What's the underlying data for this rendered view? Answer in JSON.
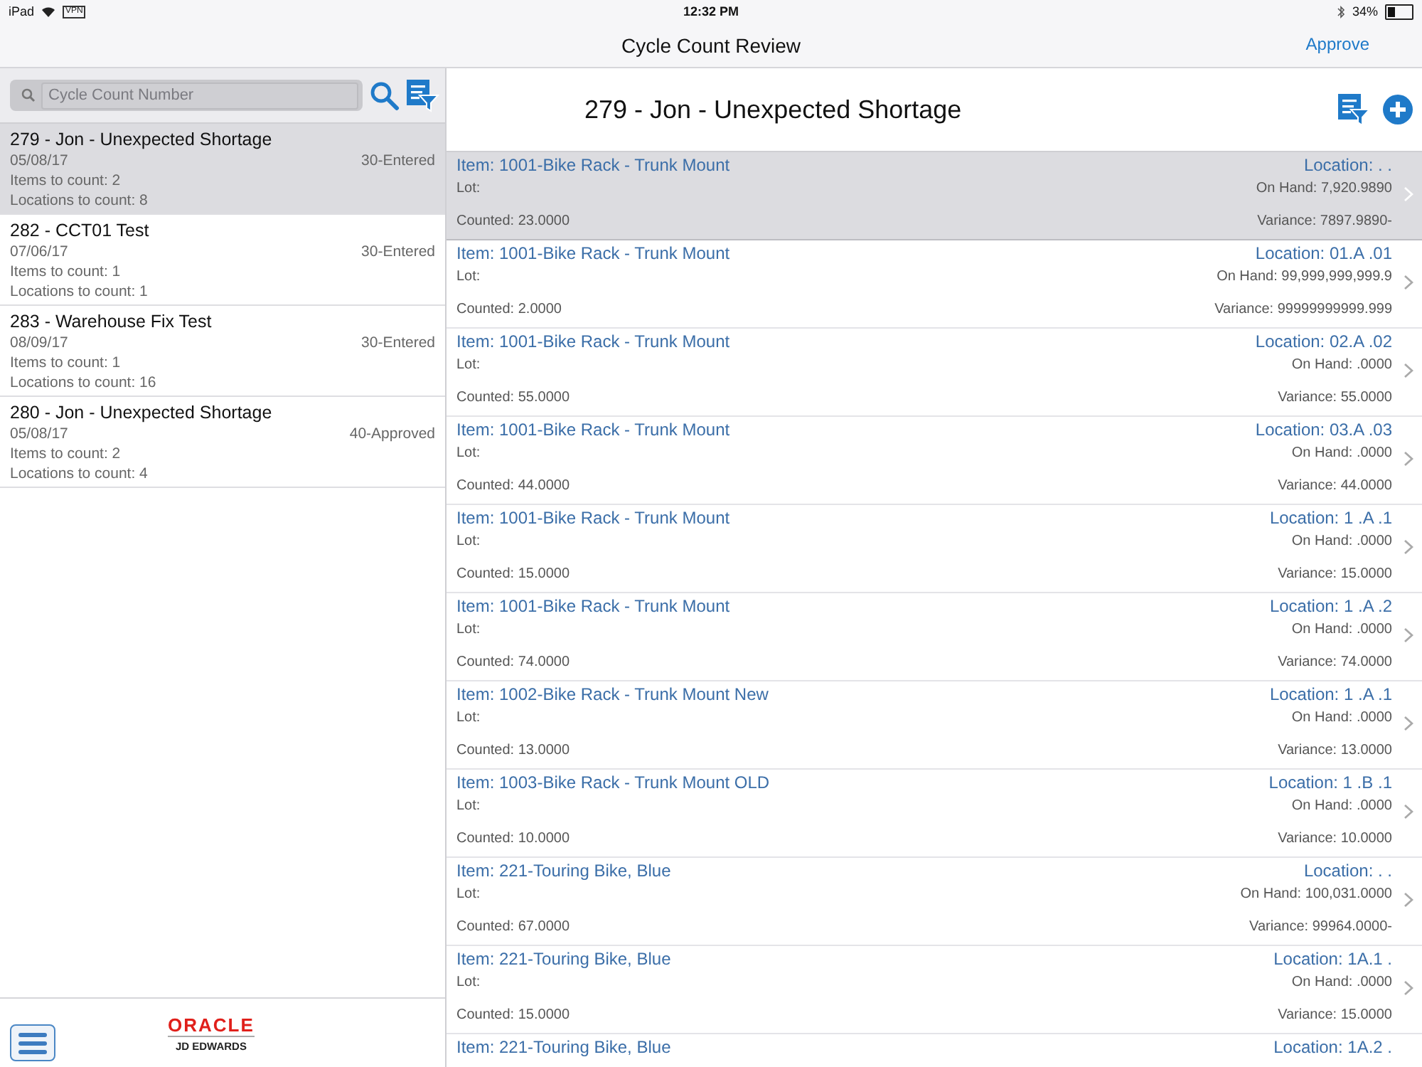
{
  "status_bar": {
    "device": "iPad",
    "vpn": "VPN",
    "time": "12:32 PM",
    "battery": "34%"
  },
  "nav": {
    "title": "Cycle Count Review",
    "action": "Approve"
  },
  "search": {
    "placeholder": "Cycle Count Number"
  },
  "counts": [
    {
      "title": "279 - Jon - Unexpected Shortage",
      "date": "05/08/17",
      "status": "30-Entered",
      "items": "Items to count: 2",
      "locations": "Locations to count: 8",
      "selected": true
    },
    {
      "title": "282 - CCT01 Test",
      "date": "07/06/17",
      "status": "30-Entered",
      "items": "Items to count: 1",
      "locations": "Locations to count: 1",
      "selected": false
    },
    {
      "title": "283 - Warehouse Fix Test",
      "date": "08/09/17",
      "status": "30-Entered",
      "items": "Items to count: 1",
      "locations": "Locations to count: 16",
      "selected": false
    },
    {
      "title": "280 - Jon - Unexpected Shortage",
      "date": "05/08/17",
      "status": "40-Approved",
      "items": "Items to count: 2",
      "locations": "Locations to count: 4",
      "selected": false
    }
  ],
  "logo": {
    "brand": "ORACLE",
    "product": "JD EDWARDS"
  },
  "detail": {
    "title": "279 - Jon - Unexpected Shortage",
    "rows": [
      {
        "item": "Item: 1001-Bike Rack - Trunk Mount",
        "location": "Location: . .",
        "lot": "Lot:",
        "on_hand": "On Hand: 7,920.9890",
        "counted": "Counted: 23.0000",
        "variance": "Variance: 7897.9890-",
        "selected": true
      },
      {
        "item": "Item: 1001-Bike Rack - Trunk Mount",
        "location": "Location: 01.A .01",
        "lot": "Lot:",
        "on_hand": "On Hand: 99,999,999,999.9",
        "counted": "Counted: 2.0000",
        "variance": "Variance: 99999999999.999",
        "selected": false
      },
      {
        "item": "Item: 1001-Bike Rack - Trunk Mount",
        "location": "Location: 02.A .02",
        "lot": "Lot:",
        "on_hand": "On Hand: .0000",
        "counted": "Counted: 55.0000",
        "variance": "Variance: 55.0000",
        "selected": false
      },
      {
        "item": "Item: 1001-Bike Rack - Trunk Mount",
        "location": "Location: 03.A .03",
        "lot": "Lot:",
        "on_hand": "On Hand: .0000",
        "counted": "Counted: 44.0000",
        "variance": "Variance: 44.0000",
        "selected": false
      },
      {
        "item": "Item: 1001-Bike Rack - Trunk Mount",
        "location": "Location: 1 .A .1",
        "lot": "Lot:",
        "on_hand": "On Hand: .0000",
        "counted": "Counted: 15.0000",
        "variance": "Variance: 15.0000",
        "selected": false
      },
      {
        "item": "Item: 1001-Bike Rack - Trunk Mount",
        "location": "Location: 1 .A .2",
        "lot": "Lot:",
        "on_hand": "On Hand: .0000",
        "counted": "Counted: 74.0000",
        "variance": "Variance: 74.0000",
        "selected": false
      },
      {
        "item": "Item: 1002-Bike Rack - Trunk Mount New",
        "location": "Location: 1 .A .1",
        "lot": "Lot:",
        "on_hand": "On Hand: .0000",
        "counted": "Counted: 13.0000",
        "variance": "Variance: 13.0000",
        "selected": false
      },
      {
        "item": "Item: 1003-Bike Rack - Trunk Mount OLD",
        "location": "Location: 1 .B .1",
        "lot": "Lot:",
        "on_hand": "On Hand: .0000",
        "counted": "Counted: 10.0000",
        "variance": "Variance: 10.0000",
        "selected": false
      },
      {
        "item": "Item: 221-Touring Bike, Blue",
        "location": "Location: . .",
        "lot": "Lot:",
        "on_hand": "On Hand: 100,031.0000",
        "counted": "Counted: 67.0000",
        "variance": "Variance: 99964.0000-",
        "selected": false
      },
      {
        "item": "Item: 221-Touring Bike, Blue",
        "location": "Location: 1A.1 .",
        "lot": "Lot:",
        "on_hand": "On Hand: .0000",
        "counted": "Counted: 15.0000",
        "variance": "Variance: 15.0000",
        "selected": false
      },
      {
        "item": "Item: 221-Touring Bike, Blue",
        "location": "Location: 1A.2 .",
        "selected": false
      }
    ]
  }
}
